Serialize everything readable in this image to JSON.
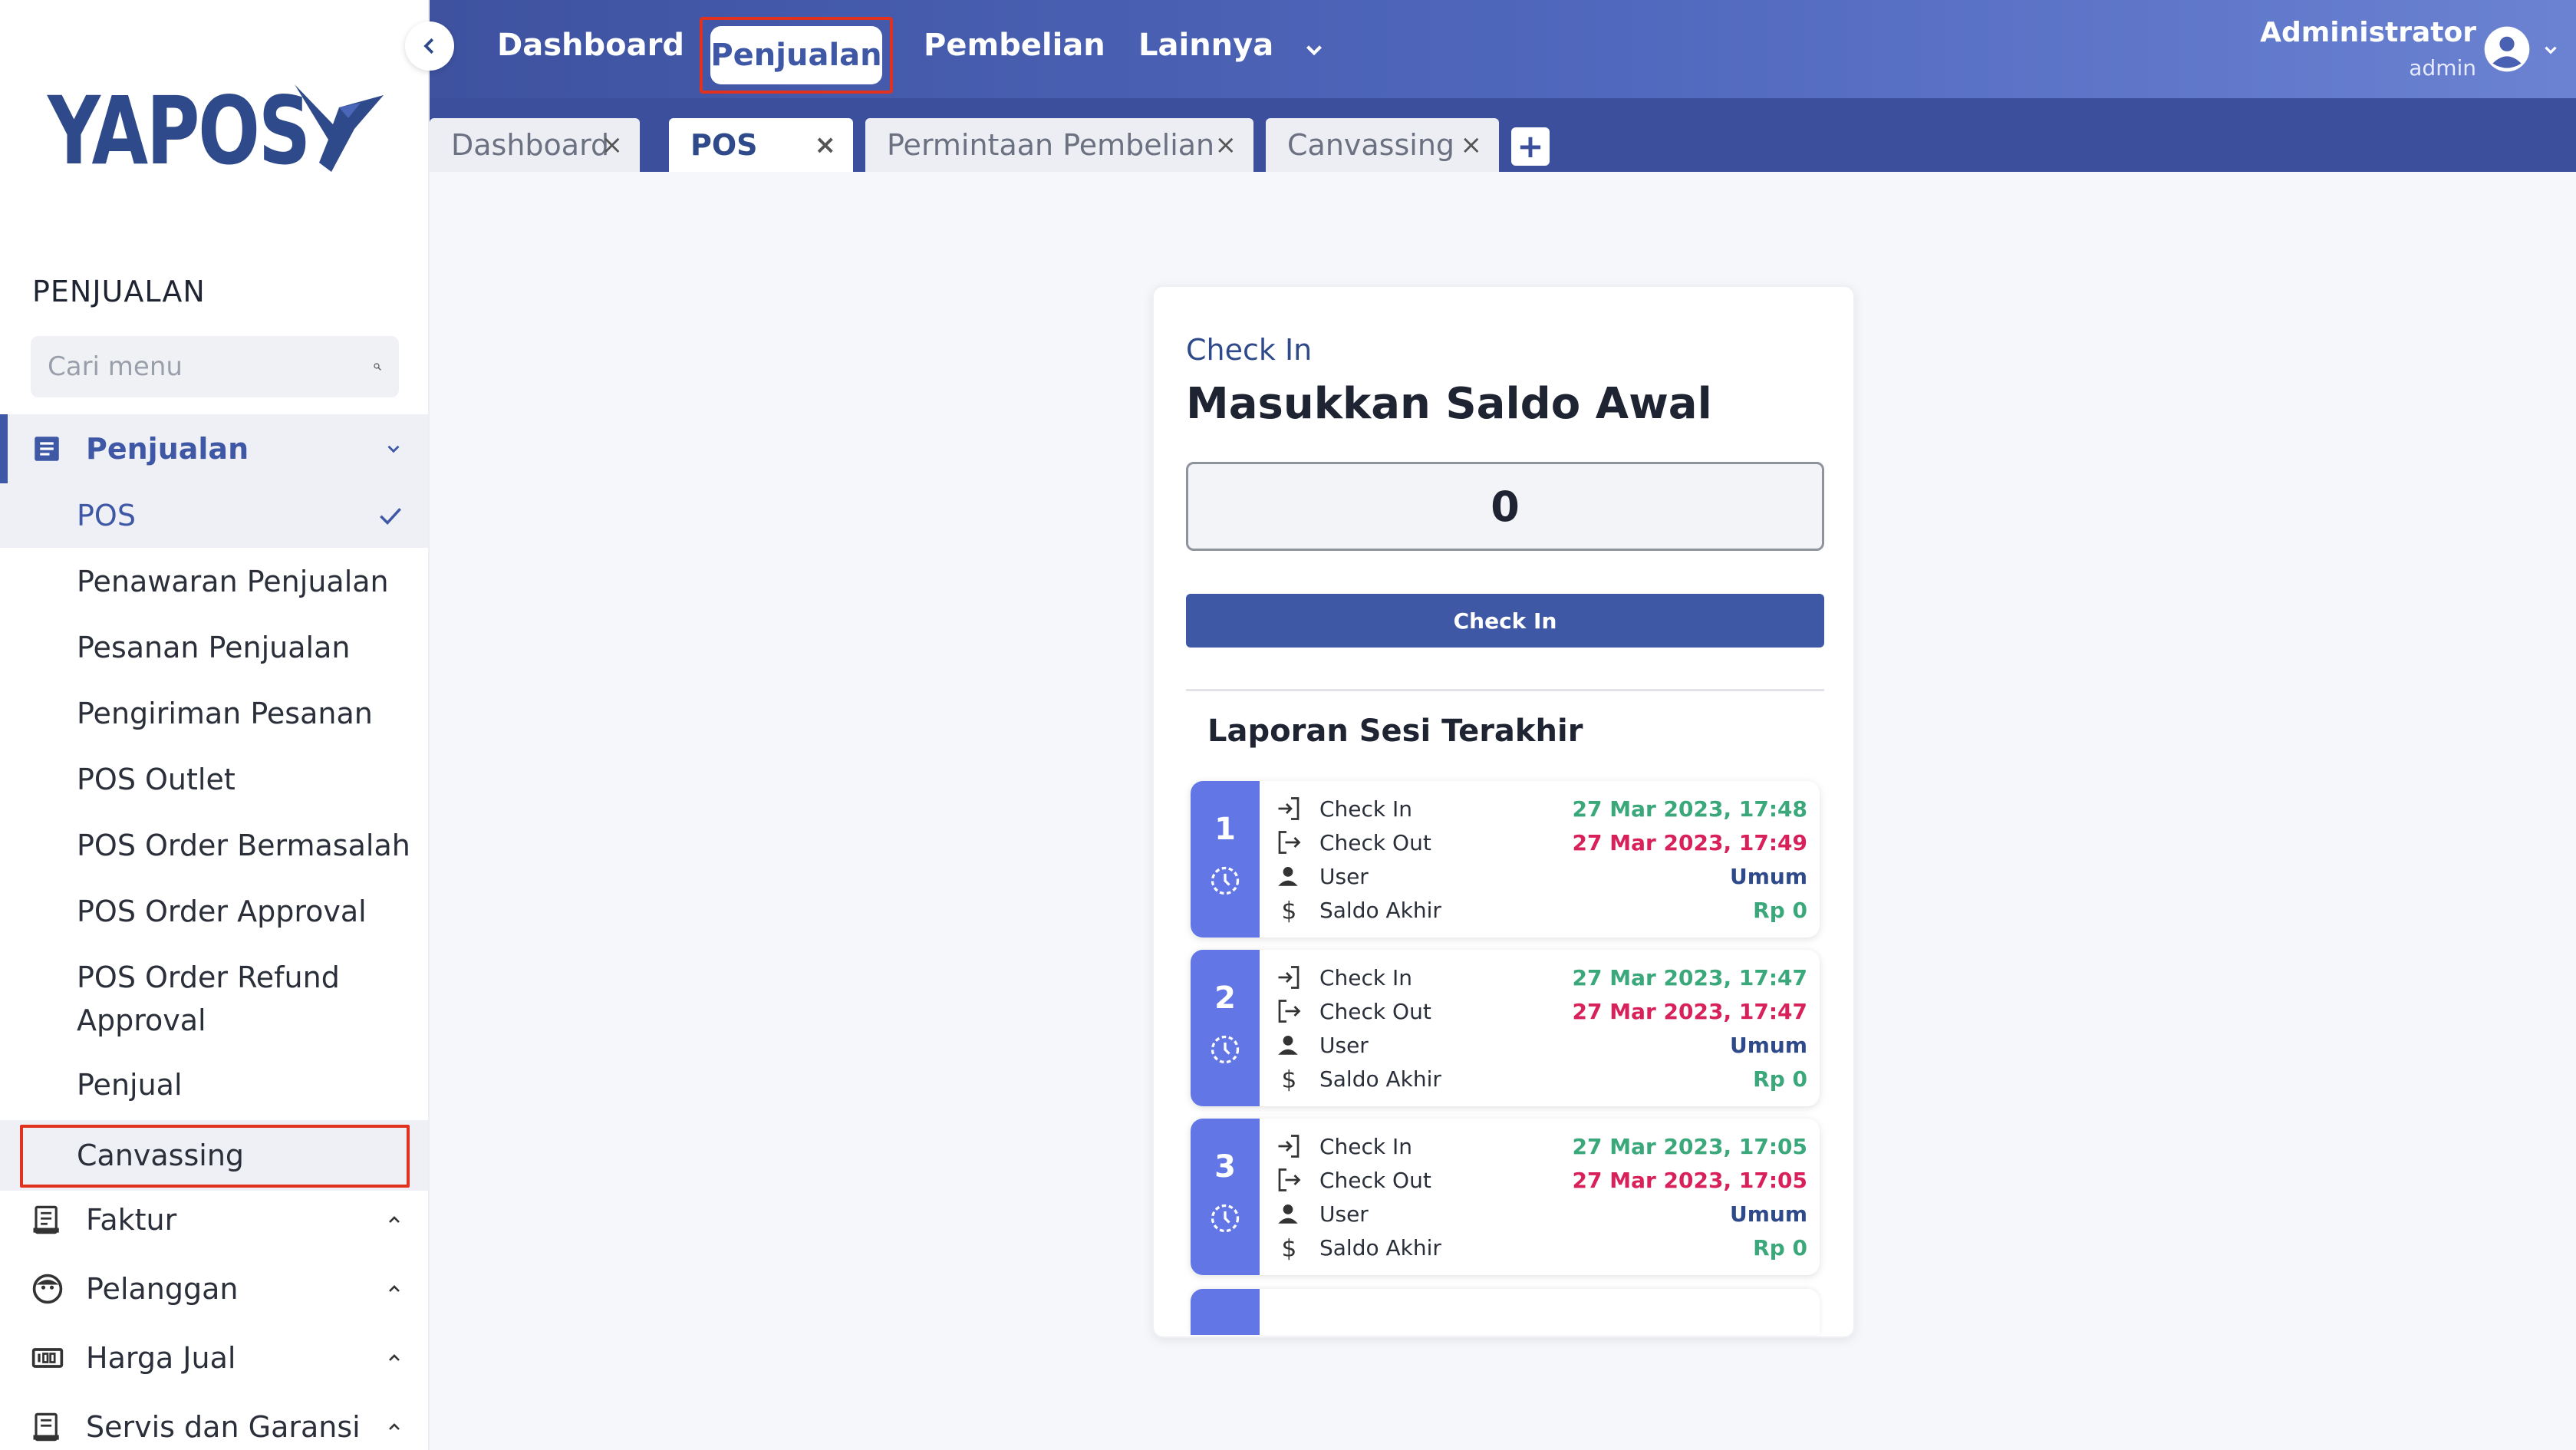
{
  "sidebar": {
    "logo_text": "YAPOS",
    "section_title": "PENJUALAN",
    "search_placeholder": "Cari menu",
    "groups": [
      {
        "label": "Penjualan",
        "icon": "receipt-icon",
        "expanded": true
      },
      {
        "label": "Faktur",
        "icon": "invoice-icon",
        "expanded": false
      },
      {
        "label": "Pelanggan",
        "icon": "customer-face-icon",
        "expanded": false
      },
      {
        "label": "Harga Jual",
        "icon": "price-tag-icon",
        "expanded": false
      },
      {
        "label": "Servis dan Garansi",
        "icon": "service-icon",
        "expanded": false
      }
    ],
    "sub_items": [
      "POS",
      "Penawaran Penjualan",
      "Pesanan Penjualan",
      "Pengiriman Pesanan",
      "POS Outlet",
      "POS Order Bermasalah",
      "POS Order Approval",
      "POS Order Refund Approval",
      "Penjual",
      "Canvassing"
    ]
  },
  "topnav": {
    "items": [
      "Dashboard",
      "Penjualan",
      "Pembelian",
      "Lainnya"
    ],
    "active": "Penjualan"
  },
  "user": {
    "name": "Administrator",
    "role": "admin"
  },
  "tabs": [
    {
      "label": "Dashboard",
      "active": false
    },
    {
      "label": "POS",
      "active": true
    },
    {
      "label": "Permintaan Pembelian",
      "active": false
    },
    {
      "label": "Canvassing",
      "active": false
    }
  ],
  "checkin": {
    "label": "Check In",
    "title": "Masukkan Saldo Awal",
    "saldo_value": "0",
    "button_label": "Check In",
    "report_title": "Laporan Sesi Terakhir"
  },
  "row_labels": {
    "check_in": "Check In",
    "check_out": "Check Out",
    "user": "User",
    "saldo_akhir": "Saldo Akhir"
  },
  "sessions": [
    {
      "number": "1",
      "check_in": "27 Mar 2023, 17:48",
      "check_out": "27 Mar 2023, 17:49",
      "user": "Umum",
      "saldo_akhir": "Rp 0"
    },
    {
      "number": "2",
      "check_in": "27 Mar 2023, 17:47",
      "check_out": "27 Mar 2023, 17:47",
      "user": "Umum",
      "saldo_akhir": "Rp 0"
    },
    {
      "number": "3",
      "check_in": "27 Mar 2023, 17:05",
      "check_out": "27 Mar 2023, 17:05",
      "user": "Umum",
      "saldo_akhir": "Rp 0"
    }
  ],
  "colors": {
    "primary": "#3f58a6",
    "session_accent": "#6276e6",
    "check_in_green": "#3aa87a",
    "check_out_red": "#d8215a",
    "highlight_red": "#e0321e"
  }
}
